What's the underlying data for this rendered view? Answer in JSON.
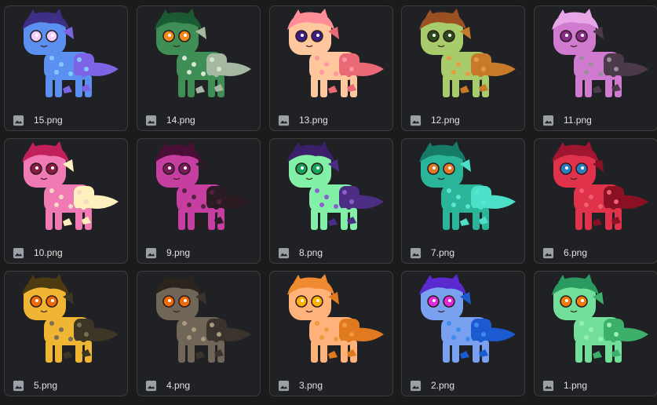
{
  "files": [
    {
      "name": "15.png",
      "icon": "image-icon",
      "body": "#5b8ff0",
      "accent": "#7d63e6",
      "spots": "#84c8ff",
      "eye": "#f0d0ff",
      "mane": "#3e2e86"
    },
    {
      "name": "14.png",
      "icon": "image-icon",
      "body": "#3f8e55",
      "accent": "#a6b8a2",
      "spots": "#d8e6d1",
      "eye": "#f08a1d",
      "mane": "#1b5a33"
    },
    {
      "name": "13.png",
      "icon": "image-icon",
      "body": "#ffc79d",
      "accent": "#e96a76",
      "spots": "#ff96a4",
      "eye": "#3e1e82",
      "mane": "#ff8e97"
    },
    {
      "name": "12.png",
      "icon": "image-icon",
      "body": "#a8cc6b",
      "accent": "#c67a2a",
      "spots": "#e79b42",
      "eye": "#2c4c1a",
      "mane": "#9a5020"
    },
    {
      "name": "11.png",
      "icon": "image-icon",
      "body": "#d07ad0",
      "accent": "#4a3a4a",
      "spots": "#9e8b9e",
      "eye": "#8a2c8a",
      "mane": "#e8a6e8"
    },
    {
      "name": "10.png",
      "icon": "image-icon",
      "body": "#f07ab4",
      "accent": "#fff0bd",
      "spots": "#f6d6c7",
      "eye": "#8a1b43",
      "mane": "#c2205a"
    },
    {
      "name": "9.png",
      "icon": "image-icon",
      "body": "#c63ea0",
      "accent": "#2b1b22",
      "spots": "#582043",
      "eye": "#7a1b5b",
      "mane": "#4a0f34"
    },
    {
      "name": "8.png",
      "icon": "image-icon",
      "body": "#82f0a6",
      "accent": "#4b2d84",
      "spots": "#8c5ed0",
      "eye": "#17a25a",
      "mane": "#3b1f6a"
    },
    {
      "name": "7.png",
      "icon": "image-icon",
      "body": "#2ab49a",
      "accent": "#4de0c8",
      "spots": "#58e6cf",
      "eye": "#e07a2a",
      "mane": "#157a66"
    },
    {
      "name": "6.png",
      "icon": "image-icon",
      "body": "#e0324b",
      "accent": "#8a1024",
      "spots": "#f06070",
      "eye": "#2b7fc0",
      "mane": "#a01530"
    },
    {
      "name": "5.png",
      "icon": "image-icon",
      "body": "#f0b532",
      "accent": "#3c3626",
      "spots": "#787052",
      "eye": "#f06a0a",
      "mane": "#4c3a10"
    },
    {
      "name": "4.png",
      "icon": "image-icon",
      "body": "#6f6657",
      "accent": "#3a342c",
      "spots": "#a89a7e",
      "eye": "#f06a0a",
      "mane": "#2a241c"
    },
    {
      "name": "3.png",
      "icon": "image-icon",
      "body": "#ffb27a",
      "accent": "#e07a20",
      "spots": "#f09a3a",
      "eye": "#ffb000",
      "mane": "#f08a30"
    },
    {
      "name": "2.png",
      "icon": "image-icon",
      "body": "#7aa0f0",
      "accent": "#1c5ad0",
      "spots": "#3c8cf0",
      "eye": "#e02adc",
      "mane": "#5a2ad0"
    },
    {
      "name": "1.png",
      "icon": "image-icon",
      "body": "#72e09a",
      "accent": "#3cb06a",
      "spots": "#96f0b4",
      "eye": "#f07a0a",
      "mane": "#2a9a60"
    }
  ]
}
